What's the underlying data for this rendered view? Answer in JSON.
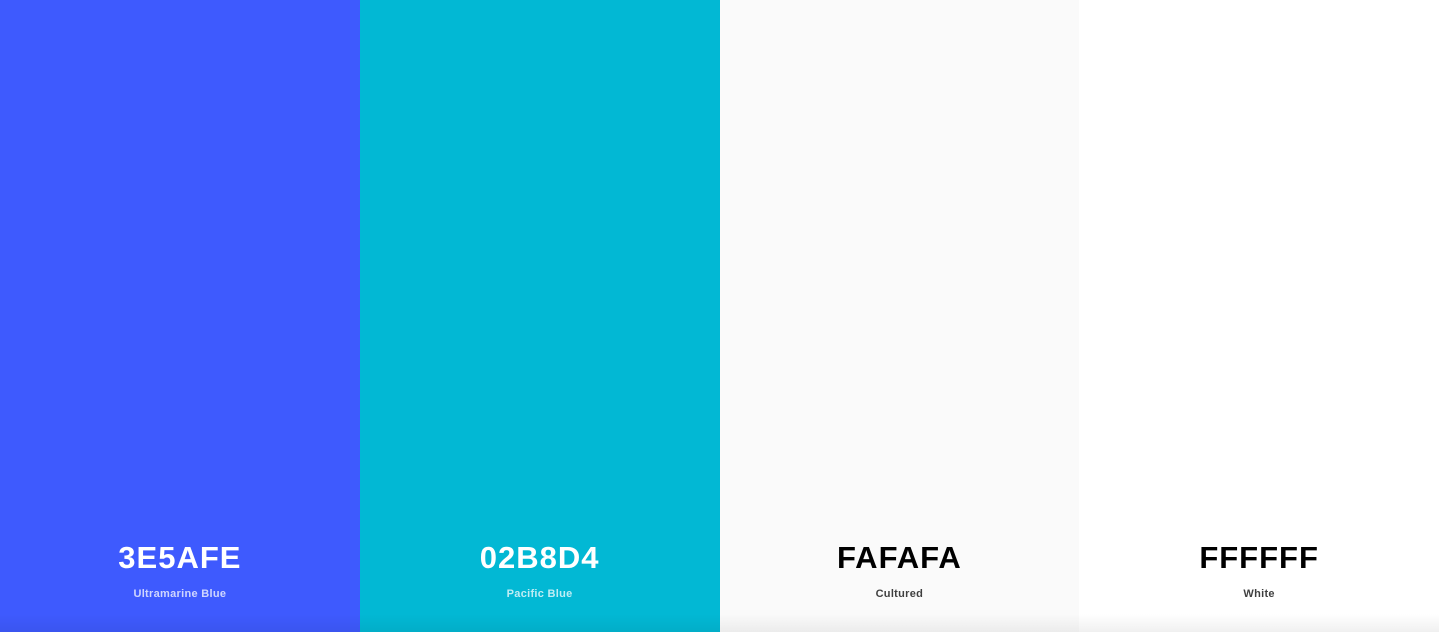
{
  "palette": {
    "swatches": [
      {
        "hex": "3E5AFE",
        "name": "Ultramarine Blue",
        "color": "#3E5AFE",
        "text_color": "#FFFFFF"
      },
      {
        "hex": "02B8D4",
        "name": "Pacific Blue",
        "color": "#02B8D4",
        "text_color": "#FFFFFF"
      },
      {
        "hex": "FAFAFA",
        "name": "Cultured",
        "color": "#FAFAFA",
        "text_color": "#000000"
      },
      {
        "hex": "FFFFFF",
        "name": "White",
        "color": "#FFFFFF",
        "text_color": "#000000"
      }
    ]
  }
}
